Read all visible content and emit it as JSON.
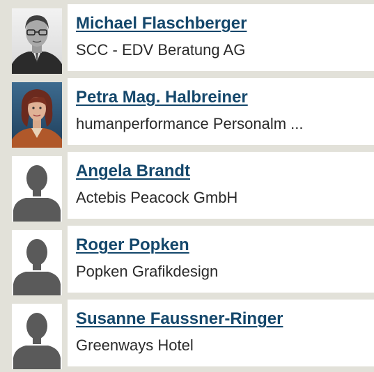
{
  "contacts": [
    {
      "name": "Michael Flaschberger",
      "company": "SCC - EDV Beratung AG",
      "avatar_icon": "photo-man-glasses-icon"
    },
    {
      "name": "Petra Mag. Halbreiner",
      "company": "humanperformance Personalm ...",
      "avatar_icon": "photo-woman-red-hair-icon"
    },
    {
      "name": "Angela Brandt",
      "company": "Actebis Peacock GmbH",
      "avatar_icon": "person-silhouette-icon"
    },
    {
      "name": "Roger Popken",
      "company": "Popken Grafikdesign",
      "avatar_icon": "person-silhouette-icon"
    },
    {
      "name": "Susanne Faussner-Ringer",
      "company": "Greenways Hotel",
      "avatar_icon": "person-silhouette-icon"
    }
  ],
  "colors": {
    "background": "#e2e1d9",
    "card": "#ffffff",
    "link": "#14476b",
    "text": "#2a2a2a",
    "silhouette": "#5a5a5a"
  }
}
